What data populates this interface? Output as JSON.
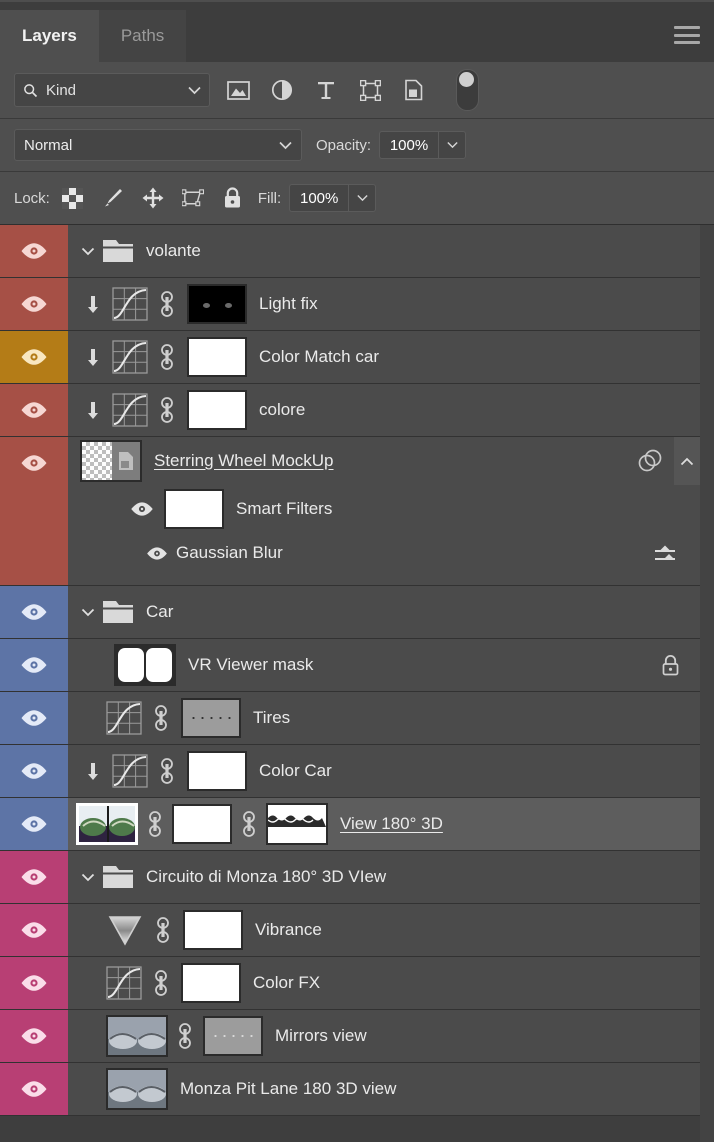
{
  "panel": {
    "tabs": [
      {
        "label": "Layers",
        "active": true
      },
      {
        "label": "Paths",
        "active": false
      }
    ],
    "menu_icon": "hamburger-menu-icon"
  },
  "filter_bar": {
    "kind_label": "Kind",
    "search_icon": "search-icon",
    "chevron_icon": "chevron-down-icon",
    "type_filters": [
      {
        "name": "pixel-layer-filter-icon"
      },
      {
        "name": "adjustment-layer-filter-icon"
      },
      {
        "name": "type-layer-filter-icon"
      },
      {
        "name": "shape-layer-filter-icon"
      },
      {
        "name": "smart-object-filter-icon"
      }
    ],
    "toggle_name": "filter-enable-toggle"
  },
  "blend_bar": {
    "blend_mode": "Normal",
    "opacity_label": "Opacity:",
    "opacity_value": "100%"
  },
  "lock_bar": {
    "lock_label": "Lock:",
    "lock_icons": [
      {
        "name": "lock-transparent-pixels-icon"
      },
      {
        "name": "lock-image-pixels-icon"
      },
      {
        "name": "lock-position-icon"
      },
      {
        "name": "lock-artboard-nesting-icon"
      },
      {
        "name": "lock-all-icon"
      }
    ],
    "fill_label": "Fill:",
    "fill_value": "100%"
  },
  "colors": {
    "eye_red": "#a65046",
    "eye_orange": "#b47c17",
    "eye_blue": "#5d74a6",
    "eye_pink": "#b83f74",
    "row_bg": "#4b4b4b",
    "row_selected_bg": "#5d5d5d",
    "panel_bg": "#4f4f4f",
    "list_bg": "#3e3e3e"
  },
  "layers": [
    {
      "name": "volante",
      "type": "group",
      "eye_color": "#a65046",
      "expanded": true,
      "indent": 0
    },
    {
      "name": "Light fix",
      "type": "adjustment-curves",
      "eye_color": "#a65046",
      "clipped": true,
      "mask": "black",
      "indent": 1
    },
    {
      "name": "Color Match car",
      "type": "adjustment-curves",
      "eye_color": "#b47c17",
      "clipped": true,
      "mask": "white",
      "indent": 1
    },
    {
      "name": "colore",
      "type": "adjustment-curves",
      "eye_color": "#a65046",
      "clipped": true,
      "mask": "white",
      "indent": 1
    },
    {
      "name": "Sterring Wheel MockUp",
      "type": "smart-object",
      "eye_color": "#a65046",
      "underlined": true,
      "has_smart_filters": true,
      "smart_filters_label": "Smart Filters",
      "filters": [
        {
          "name": "Gaussian Blur"
        }
      ],
      "indent": 1
    },
    {
      "name": "Car",
      "type": "group",
      "eye_color": "#5d74a6",
      "expanded": true,
      "indent": 0
    },
    {
      "name": "VR Viewer mask",
      "type": "pixel",
      "eye_color": "#5d74a6",
      "locked": true,
      "indent": 1
    },
    {
      "name": "Tires",
      "type": "adjustment-curves",
      "eye_color": "#5d74a6",
      "mask": "grey-dots",
      "indent": 1
    },
    {
      "name": "Color Car",
      "type": "adjustment-curves",
      "eye_color": "#5d74a6",
      "clipped": true,
      "mask": "white",
      "indent": 1
    },
    {
      "name": "View  180° 3D",
      "type": "pixel",
      "eye_color": "#5d74a6",
      "selected": true,
      "underlined": true,
      "mask": "white",
      "vector_mask": true,
      "indent": 1
    },
    {
      "name": "Circuito di Monza 180° 3D VIew",
      "type": "group",
      "eye_color": "#b83f74",
      "expanded": true,
      "indent": 0
    },
    {
      "name": "Vibrance",
      "type": "adjustment-vibrance",
      "eye_color": "#b83f74",
      "mask": "white",
      "indent": 1
    },
    {
      "name": "Color FX",
      "type": "adjustment-curves",
      "eye_color": "#b83f74",
      "mask": "white",
      "indent": 1
    },
    {
      "name": "Mirrors view",
      "type": "pixel",
      "eye_color": "#b83f74",
      "mask": "grey-dots",
      "indent": 1
    },
    {
      "name": "Monza Pit Lane 180 3D view",
      "type": "pixel",
      "eye_color": "#b83f74",
      "indent": 1
    }
  ]
}
